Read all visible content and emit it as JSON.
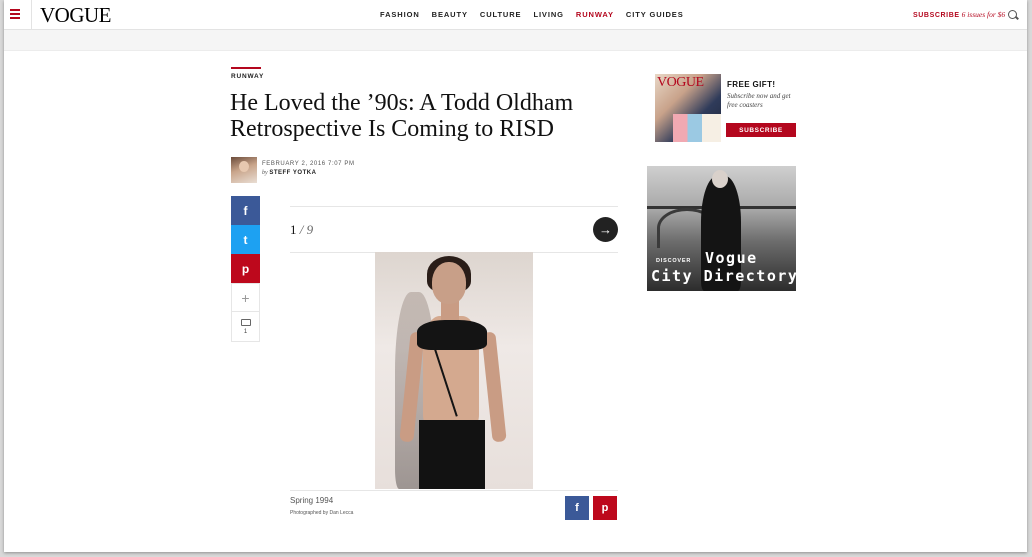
{
  "header": {
    "logo": "VOGUE",
    "nav": [
      "FASHION",
      "BEAUTY",
      "CULTURE",
      "LIVING",
      "RUNWAY",
      "CITY GUIDES"
    ],
    "active_nav": "RUNWAY",
    "subscribe_label": "SUBSCRIBE",
    "subscribe_offer": "6 issues for $6"
  },
  "article": {
    "section": "RUNWAY",
    "headline": "He Loved the ’90s: A Todd Oldham Retrospective Is Coming to RISD",
    "date": "FEBRUARY 2, 2016",
    "time": "7:07 PM",
    "by": "by",
    "author": "STEFF YOTKA"
  },
  "share": {
    "facebook": "f",
    "twitter": "t",
    "pinterest": "p",
    "more": "+",
    "comment_count": "1"
  },
  "gallery": {
    "current": "1",
    "separator": "/",
    "total": "9",
    "next": "→",
    "caption_title": "Spring 1994",
    "caption_credit": "Photographed by Dan Lecca"
  },
  "ads": {
    "mag_logo": "VOGUE",
    "gift_title": "FREE GIFT!",
    "gift_text": "Subscribe now and get free coasters",
    "gift_button": "SUBSCRIBE",
    "discover": "DISCOVER",
    "vogue": "Vogue",
    "city_directory": "City Directory"
  },
  "colors": {
    "brand_red": "#b4071e",
    "facebook": "#3b5998",
    "twitter": "#1da1f2",
    "pinterest": "#bd081c"
  }
}
